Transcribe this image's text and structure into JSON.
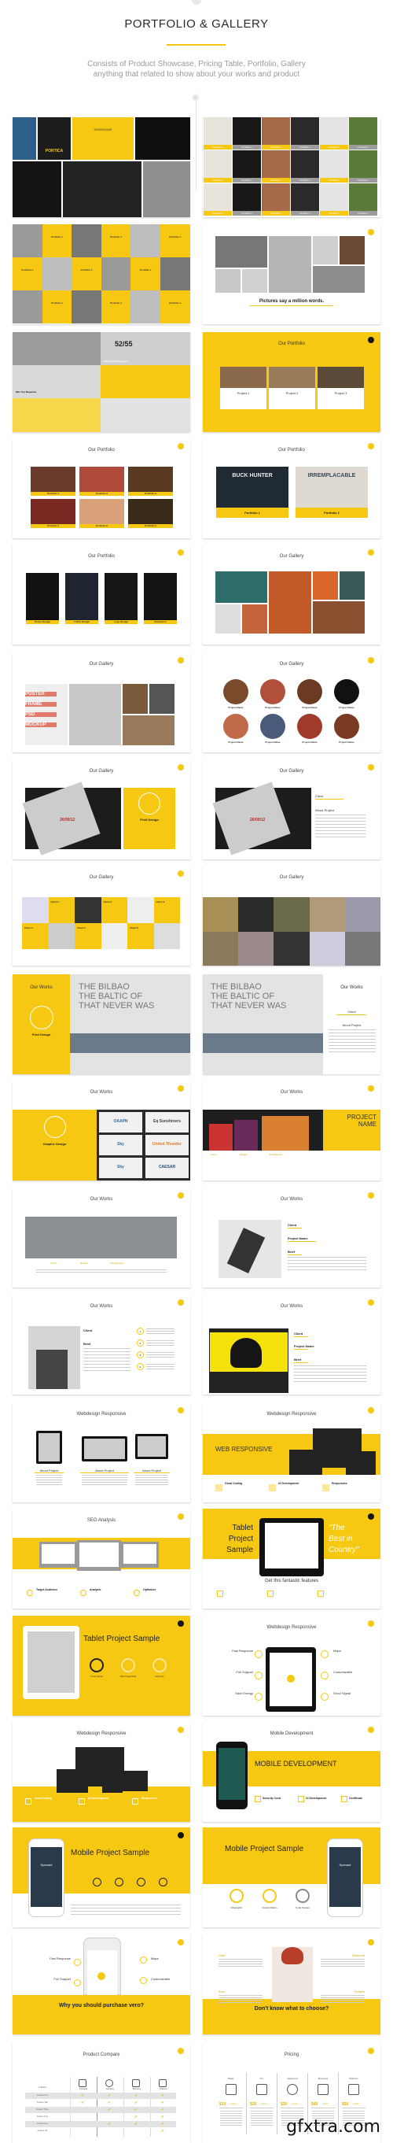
{
  "header": {
    "title": "PORTFOLIO & GALLERY",
    "subtitle_line1": "Consists of Product Showcase, Pricing Table, Portfolio, Gallery",
    "subtitle_line2": "anything that related to show about your works and product"
  },
  "colors": {
    "accent": "#f6c812",
    "dark": "#151515",
    "text": "#2a2a2a",
    "muted": "#9a9a9a"
  },
  "slides": {
    "s1": {
      "box_title": "SHOWCASE",
      "brand": "PORTICA"
    },
    "s2": {
      "labels": [
        "Portfolio 1",
        "Portfolio 1",
        "Portfolio 1",
        "Portfolio 1",
        "Portfolio 1",
        "Portfolio 1",
        "Portfolio 1",
        "Portfolio 1",
        "Portfolio 1",
        "Portfolio 1",
        "Portfolio 1",
        "Portfolio 1",
        "Portfolio 1",
        "Portfolio 1",
        "Portfolio 1",
        "Portfolio 1",
        "Portfolio 1",
        "Portfolio 1"
      ]
    },
    "s3": {
      "labels": [
        "Portfolio 1",
        "Portfolio 1",
        "Portfolio 1",
        "Portfolio 1",
        "Portfolio 1",
        "Portfolio 1",
        "Portfolio 1",
        "Portfolio 1",
        "Portfolio 1"
      ]
    },
    "s4": {
      "heading": "Pictures say a million words."
    },
    "s5": {
      "caption1": "Max Top Magazine",
      "caption2": "High Sound Magazine",
      "numbers": "52/55"
    },
    "s6": {
      "title": "Our Portfolio",
      "cards": [
        "Project 1",
        "Project 2",
        "Project 3"
      ]
    },
    "s7": {
      "title": "Our Portfolio",
      "labels": [
        "Portfolio 1",
        "Portfolio 2",
        "Portfolio 3",
        "Portfolio 4",
        "Portfolio 5",
        "Portfolio 6"
      ]
    },
    "s8": {
      "title": "Our Portfolio",
      "cards": [
        "Portfolio 1",
        "Portfolio 1"
      ],
      "art": [
        "BUCK HUNTER",
        "IRREMPLACABLE"
      ]
    },
    "s9": {
      "title": "Our Portfolio",
      "labels": [
        "Poster Design",
        "T-Shirt Design",
        "Logo Design",
        "Illustration"
      ]
    },
    "s10": {
      "title": "Our Gallery"
    },
    "s11": {
      "title": "Our Gallery",
      "poster": [
        "POSTER",
        "FRAME",
        "PSD",
        "MOCKUP"
      ]
    },
    "s12": {
      "title": "Our Gallery",
      "names": [
        "Project Name",
        "Project Name",
        "Project Name",
        "Project Name",
        "Project Name",
        "Project Name",
        "Project Name",
        "Project Name"
      ]
    },
    "s13": {
      "title": "Our Gallery",
      "box_title": "Print Design",
      "date": "26/09/12"
    },
    "s14": {
      "title": "Our Gallery",
      "client": "Client",
      "about": "About Project",
      "date": "26/09/12"
    },
    "s15": {
      "title": "Our Gallery",
      "labels": [
        "Client 1",
        "Client 2",
        "Client 3",
        "Client 4",
        "Client 5",
        "Client 6"
      ]
    },
    "s16": {
      "title": "Our Gallery"
    },
    "s17": {
      "title": "Our Works",
      "box_title": "Print Design",
      "headline": [
        "THE BILBAO",
        "THE BALTIC OF",
        "THAT NEVER WAS"
      ]
    },
    "s18": {
      "title": "Our Works",
      "client": "Client",
      "about": "About Project",
      "headline": [
        "THE BILBAO",
        "THE BALTIC OF",
        "THAT NEVER WAS"
      ]
    },
    "s19": {
      "title": "Our Works",
      "box_title": "Graphic Design",
      "logos": [
        "OAAPN",
        "Eq Sunshiners",
        "Sky",
        "United Thunder",
        "Sky",
        "CAESAR"
      ]
    },
    "s20": {
      "title": "Our Works",
      "project": [
        "PROJECT",
        "NAME"
      ],
      "meta": [
        "Client",
        "Budget",
        "Job Request"
      ]
    },
    "s21": {
      "title": "Our Works",
      "meta": [
        "Client",
        "Budget",
        "Job Request"
      ]
    },
    "s22": {
      "title": "Our Works",
      "fields": [
        "Client",
        "Project Name",
        "Brief"
      ]
    },
    "s23": {
      "title": "Our Works",
      "fields": [
        "Client",
        "Brief"
      ],
      "steps": [
        "1",
        "2",
        "3",
        "4"
      ]
    },
    "s24": {
      "title": "Our Works",
      "fields": [
        "Client",
        "Project Name",
        "Brief"
      ]
    },
    "s25": {
      "title": "Webdesign Responsive",
      "labels": [
        "About Project",
        "About Project",
        "About Project"
      ]
    },
    "s26": {
      "title": "Webdesign Responsive",
      "heading": "WEB RESPONSIVE",
      "features": [
        "Great Coding",
        "UI Development",
        "Responsive"
      ]
    },
    "s27": {
      "title": "SEO Analysis",
      "features": [
        "Target Audience",
        "Analysis",
        "Optimizer"
      ]
    },
    "s28": {
      "heading": [
        "Tablet",
        "Project",
        "Sample"
      ],
      "quote": [
        "\"The",
        "Best in",
        "Country\""
      ],
      "tagline": "Get this fantastic features"
    },
    "s29": {
      "heading": "Tablet Project Sample",
      "features": [
        "Fresh Ideas",
        "Well Organized",
        "Add-ons"
      ]
    },
    "s30": {
      "title": "Webdesign Responsive",
      "left": [
        "Fast Response",
        "Full Support",
        "Save Energy"
      ],
      "right": [
        "Maps",
        "Customizable",
        "Good Signal"
      ]
    },
    "s31": {
      "title": "Webdesign Responsive",
      "features": [
        "Great Coding",
        "UI Development",
        "Responsive"
      ]
    },
    "s32": {
      "title": "Mobile Development",
      "heading": "MOBILE DEVELOPMENT",
      "features": [
        "Security Code",
        "UI Development",
        "Certificate"
      ]
    },
    "s33": {
      "heading": "Mobile Project Sample",
      "app": "Spenant"
    },
    "s34": {
      "heading": "Mobile Project Sample",
      "features": [
        "Infographic",
        "Customization",
        "Code System"
      ],
      "app": "Spenant"
    },
    "s35": {
      "left": [
        "Fast Response",
        "Full Support"
      ],
      "right": [
        "Maps",
        "Customizable"
      ],
      "heading": "Why you should purchase vero?"
    },
    "s36": {
      "options": [
        "Gold",
        "Diamond",
        "Euro",
        "Dollar's"
      ],
      "heading": "Don't know what to choose?"
    },
    "s37": {
      "title": "Product Compare",
      "columns": [
        "Personal",
        "Company",
        "Business",
        "Platinum"
      ],
      "first_header": "Features",
      "rows": [
        {
          "label": "Feature One",
          "checks": [
            true,
            true,
            true,
            true
          ]
        },
        {
          "label": "Feature Two",
          "checks": [
            true,
            true,
            true,
            true
          ]
        },
        {
          "label": "Feature Three",
          "checks": [
            false,
            true,
            true,
            true
          ]
        },
        {
          "label": "Feature Four",
          "checks": [
            false,
            false,
            true,
            true
          ]
        },
        {
          "label": "Feature Five",
          "checks": [
            false,
            true,
            true,
            true
          ]
        },
        {
          "label": "Feature Six",
          "checks": [
            false,
            false,
            false,
            true
          ]
        }
      ]
    },
    "s38": {
      "title": "Pricing",
      "plans": [
        {
          "name": "Basic",
          "price": "$10",
          "period": "/month"
        },
        {
          "name": "Pro",
          "price": "$20",
          "period": "/month"
        },
        {
          "name": "Advanced",
          "price": "$30",
          "period": "/month"
        },
        {
          "name": "Business",
          "price": "$40",
          "period": "/month"
        },
        {
          "name": "Platinum",
          "price": "$50",
          "period": "/month"
        }
      ]
    }
  },
  "watermark": "gfxtra.com"
}
